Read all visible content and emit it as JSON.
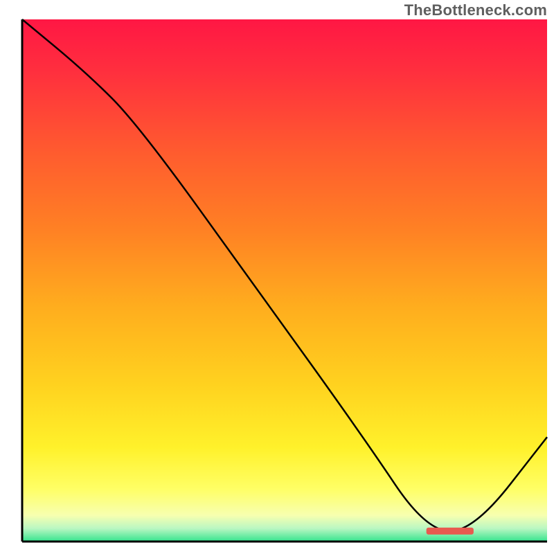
{
  "attribution": "TheBottleneck.com",
  "colors": {
    "axis": "#000000",
    "line": "#000000",
    "marker": "#e85a4f",
    "gradient_stops": [
      {
        "offset": 0.0,
        "color": "#ff1744"
      },
      {
        "offset": 0.1,
        "color": "#ff2f3e"
      },
      {
        "offset": 0.25,
        "color": "#ff5a2f"
      },
      {
        "offset": 0.4,
        "color": "#ff8024"
      },
      {
        "offset": 0.55,
        "color": "#ffad1e"
      },
      {
        "offset": 0.7,
        "color": "#ffd21f"
      },
      {
        "offset": 0.82,
        "color": "#fff12b"
      },
      {
        "offset": 0.9,
        "color": "#ffff66"
      },
      {
        "offset": 0.95,
        "color": "#f7ffb0"
      },
      {
        "offset": 0.975,
        "color": "#b9f7c2"
      },
      {
        "offset": 1.0,
        "color": "#34e38d"
      }
    ]
  },
  "chart_data": {
    "type": "line",
    "title": "",
    "xlabel": "",
    "ylabel": "",
    "xlim": [
      0,
      100
    ],
    "ylim": [
      0,
      100
    ],
    "x": [
      0,
      12,
      22,
      45,
      65,
      77,
      86,
      100
    ],
    "values": [
      100,
      90,
      80,
      48,
      20,
      2,
      2,
      20
    ],
    "marker": {
      "x_start": 77,
      "x_end": 86,
      "y": 2
    },
    "annotations": []
  }
}
